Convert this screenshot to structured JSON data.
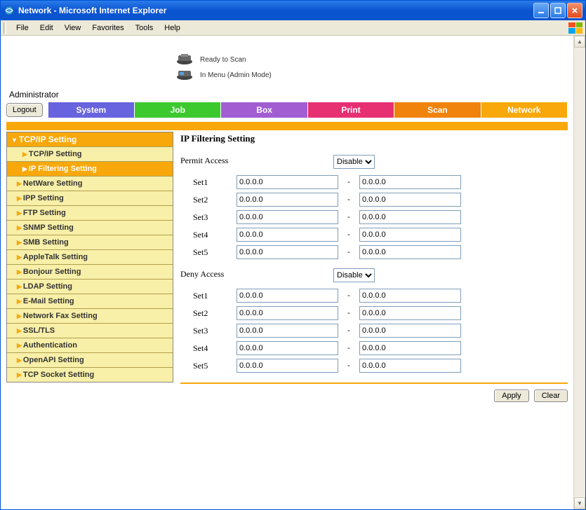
{
  "window": {
    "title": "Network - Microsoft Internet Explorer"
  },
  "menubar": [
    "File",
    "Edit",
    "View",
    "Favorites",
    "Tools",
    "Help"
  ],
  "status": {
    "line1": "Ready to Scan",
    "line2": "In Menu (Admin Mode)"
  },
  "admin_label": "Administrator",
  "logout": "Logout",
  "tabs": {
    "system": "System",
    "job": "Job",
    "box": "Box",
    "print": "Print",
    "scan": "Scan",
    "network": "Network"
  },
  "sidebar": {
    "header": "TCP/IP Setting",
    "items": [
      "TCP/IP Setting",
      "IP Filtering Setting",
      "NetWare Setting",
      "IPP Setting",
      "FTP Setting",
      "SNMP Setting",
      "SMB Setting",
      "AppleTalk Setting",
      "Bonjour Setting",
      "LDAP Setting",
      "E-Mail Setting",
      "Network Fax Setting",
      "SSL/TLS",
      "Authentication",
      "OpenAPI Setting",
      "TCP Socket Setting"
    ]
  },
  "main": {
    "title": "IP Filtering Setting",
    "permit_label": "Permit Access",
    "deny_label": "Deny Access",
    "disable_option": "Disable",
    "sets": {
      "s1": "Set1",
      "s2": "Set2",
      "s3": "Set3",
      "s4": "Set4",
      "s5": "Set5"
    },
    "ip_default": "0.0.0.0",
    "dash": "-",
    "apply": "Apply",
    "clear": "Clear"
  }
}
